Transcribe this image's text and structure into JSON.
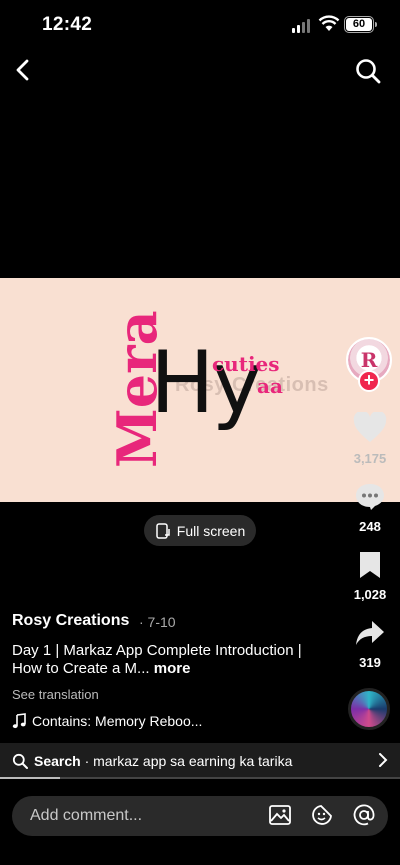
{
  "status_bar": {
    "time": "12:42",
    "battery": "60"
  },
  "video": {
    "watermark": "Rosy Creations",
    "text_mera": "Mera",
    "text_hy": "Hy",
    "text_cuties": "cuties",
    "text_aa": "aa"
  },
  "actions": {
    "likes": "3,175",
    "comments": "248",
    "saves": "1,028",
    "shares": "319"
  },
  "fullscreen_label": "Full screen",
  "post": {
    "author": "Rosy Creations",
    "date": "· 7-10",
    "caption": "Day 1 | Markaz App Complete Introduction | How to Create a M...",
    "more": "more",
    "see_translation": "See translation",
    "sound": "Contains: Memory Reboo..."
  },
  "search_bar": {
    "prefix": "Search",
    "query": "· markaz app sa earning ka tarika"
  },
  "progress": 0.15,
  "comment_bar": {
    "placeholder": "Add comment..."
  },
  "colors": {
    "accent_pink": "#e8277b",
    "follow_red": "#f0264e",
    "video_bg": "#f9e0d2"
  }
}
